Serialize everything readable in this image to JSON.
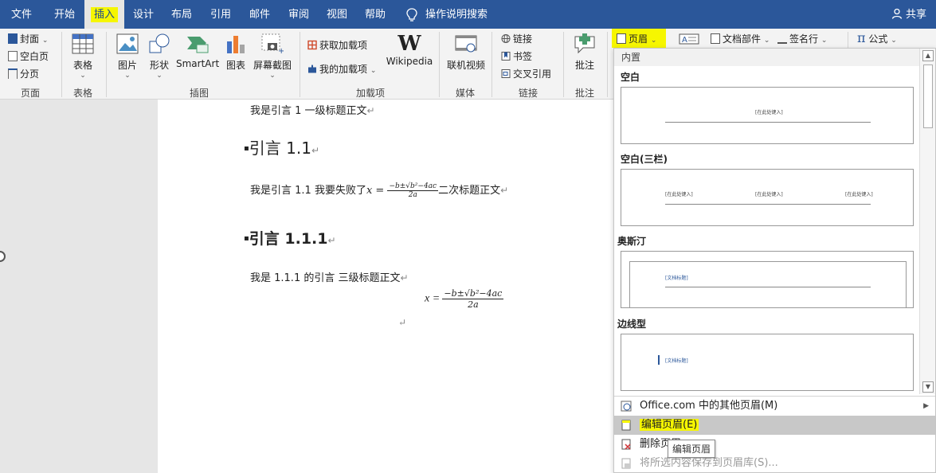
{
  "tabs": [
    {
      "label": "文件"
    },
    {
      "label": "开始"
    },
    {
      "label": "插入"
    },
    {
      "label": "设计"
    },
    {
      "label": "布局"
    },
    {
      "label": "引用"
    },
    {
      "label": "邮件"
    },
    {
      "label": "审阅"
    },
    {
      "label": "视图"
    },
    {
      "label": "帮助"
    }
  ],
  "tell_me": "操作说明搜索",
  "share": "共享",
  "ribbon": {
    "pages": {
      "cover": "封面",
      "blank": "空白页",
      "break": "分页",
      "label": "页面"
    },
    "tables": {
      "table": "表格",
      "label": "表格"
    },
    "illustrations": {
      "picture": "图片",
      "shapes": "形状",
      "smartart": "SmartArt",
      "chart": "图表",
      "screenshot": "屏幕截图",
      "label": "插图"
    },
    "addins": {
      "get": "获取加载项",
      "mine": "我的加载项",
      "wikipedia": "Wikipedia",
      "wiki_glyph": "W",
      "label": "加载项"
    },
    "media": {
      "video": "联机视频",
      "label": "媒体"
    },
    "links": {
      "link": "链接",
      "bookmark": "书签",
      "crossref": "交叉引用",
      "label": "链接"
    },
    "comments": {
      "comment": "批注",
      "label": "批注"
    },
    "header_btn": "页眉",
    "quickparts": "文档部件",
    "signature": "签名行",
    "equation": "公式",
    "pi_glyph": "π"
  },
  "document": {
    "line1": "我是引言 1  一级标题正文",
    "h2": "引言 1.1",
    "line2_a": "我是引言 1.1  我要失败了",
    "line2_b": "二次标题正文",
    "h3": "引言 1.1.1",
    "line3": "我是 1.1.1 的引言  三级标题正文",
    "formula": {
      "lhs": "x =",
      "num": "−b±√b²−4ac",
      "den": "2a"
    },
    "return_mark": "↵"
  },
  "dropdown": {
    "section_builtin": "内置",
    "items": [
      {
        "name": "空白",
        "t1": "[在此处键入]"
      },
      {
        "name": "空白(三栏)",
        "t1": "[在此处键入]",
        "t2": "[在此处键入]",
        "t3": "[在此处键入]"
      },
      {
        "name": "奥斯汀",
        "t1": "[文档标题]"
      },
      {
        "name": "边线型",
        "t1": "[文档标题]"
      }
    ],
    "menu": {
      "more": "Office.com 中的其他页眉(M)",
      "edit": "编辑页眉(E)",
      "remove": "删除页眉",
      "save": "将所选内容保存到页眉库(S)..."
    },
    "tooltip": "编辑页眉"
  }
}
